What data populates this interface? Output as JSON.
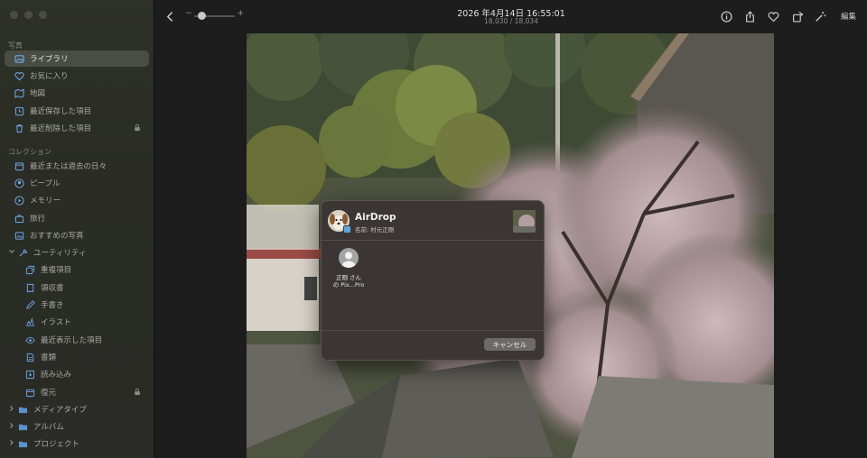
{
  "sidebar": {
    "sections": {
      "photos": "写真",
      "collections": "コレクション"
    },
    "items": [
      {
        "label": "ライブラリ",
        "icon": "library-icon"
      },
      {
        "label": "お気に入り",
        "icon": "heart-icon"
      },
      {
        "label": "地図",
        "icon": "map-icon"
      },
      {
        "label": "最近保存した項目",
        "icon": "recently-saved-icon"
      },
      {
        "label": "最近削除した項目",
        "icon": "trash-icon"
      },
      {
        "label": "最近または過去の日々",
        "icon": "calendar-icon"
      },
      {
        "label": "ピープル",
        "icon": "people-icon"
      },
      {
        "label": "メモリー",
        "icon": "memories-icon"
      },
      {
        "label": "旅行",
        "icon": "suitcase-icon"
      },
      {
        "label": "おすすめの写真",
        "icon": "featured-photos-icon"
      },
      {
        "label": "ユーティリティ",
        "icon": "utilities-icon"
      },
      {
        "label": "重複項目",
        "icon": "duplicates-icon"
      },
      {
        "label": "領収書",
        "icon": "receipt-icon"
      },
      {
        "label": "手書き",
        "icon": "handwriting-icon"
      },
      {
        "label": "イラスト",
        "icon": "illustration-icon"
      },
      {
        "label": "最近表示した項目",
        "icon": "eye-icon"
      },
      {
        "label": "書類",
        "icon": "document-icon"
      },
      {
        "label": "読み込み",
        "icon": "import-icon"
      },
      {
        "label": "復元",
        "icon": "recovered-icon"
      },
      {
        "label": "メディアタイプ",
        "icon": "folder-icon"
      },
      {
        "label": "アルバム",
        "icon": "folder-icon"
      },
      {
        "label": "プロジェクト",
        "icon": "folder-icon"
      }
    ]
  },
  "toolbar": {
    "zoom_minus": "−",
    "zoom_plus": "+",
    "date": "2026 年4月14日 16:55:01",
    "count": "18,030 / 18,034",
    "edit_label": "編集"
  },
  "airdrop": {
    "title": "AirDrop",
    "subtitle": "名前: 村元正剛",
    "device_name_line1": "正剛 さん",
    "device_name_line2": "の Pix...Pro",
    "cancel_label": "キャンセル"
  },
  "colors": {
    "sidebar_bg": "#2b2c26",
    "selected_bg": "#4a4c46",
    "sheet_bg": "#3b3633"
  }
}
